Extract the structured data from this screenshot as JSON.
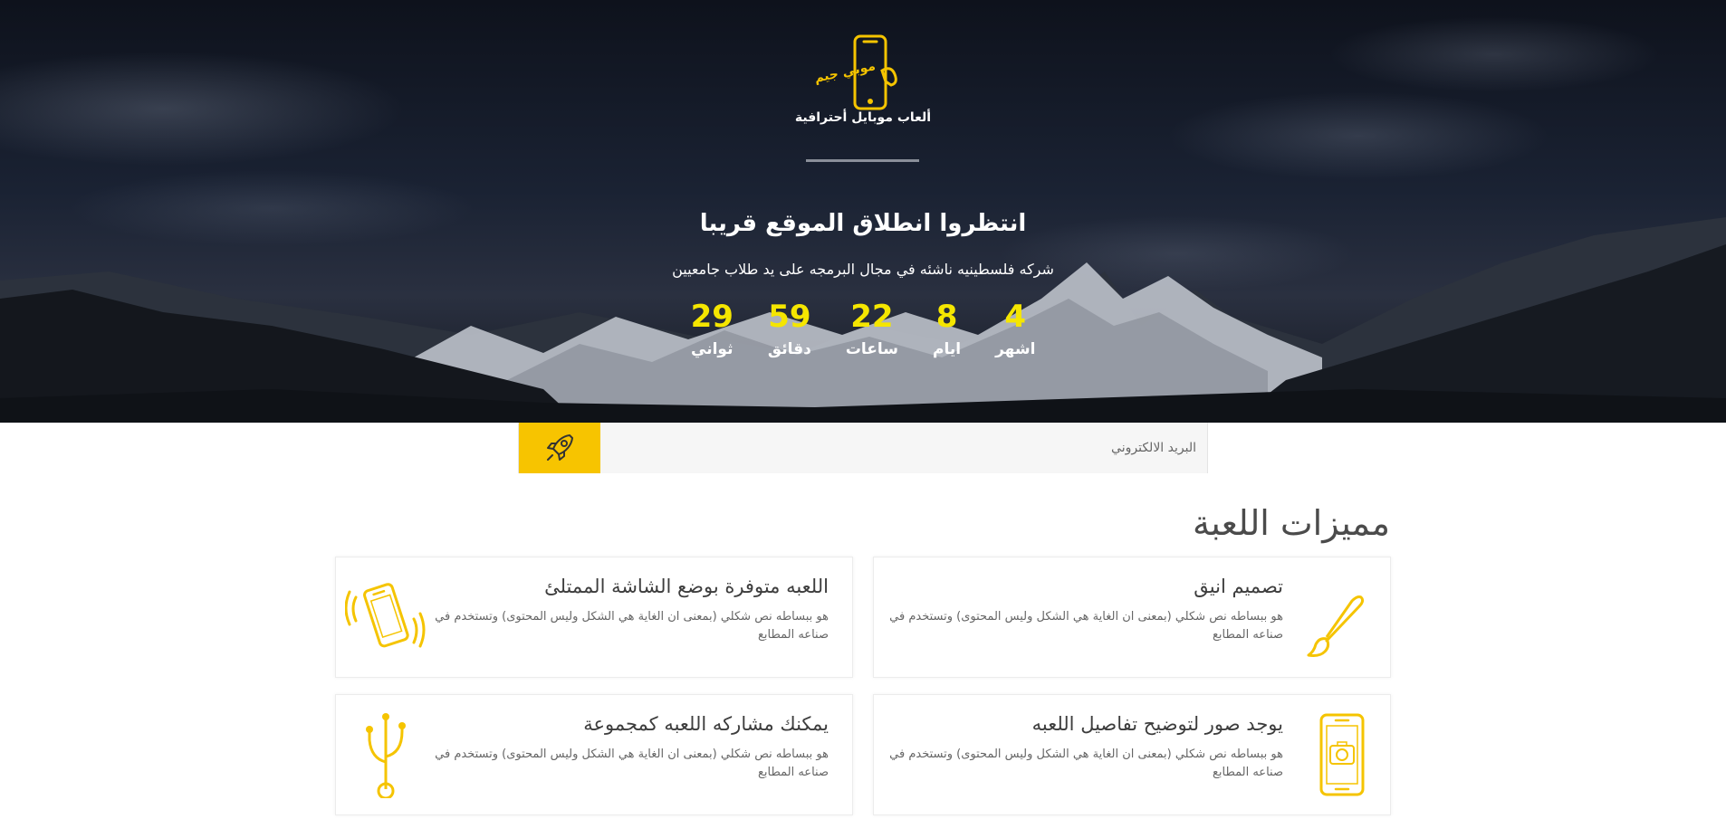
{
  "hero": {
    "logo_brand": "موبي جيم",
    "logo_tagline": "ألعاب موبايل أحترافية",
    "title": "انتظروا انطلاق الموقع قريبا",
    "subtitle": "شركه فلسطينيه ناشئه في مجال البرمجه على يد طلاب جامعيين"
  },
  "countdown": [
    {
      "value": "4",
      "label": "اشهر"
    },
    {
      "value": "8",
      "label": "ايام"
    },
    {
      "value": "22",
      "label": "ساعات"
    },
    {
      "value": "59",
      "label": "دقائق"
    },
    {
      "value": "29",
      "label": "ثواني"
    }
  ],
  "subscribe": {
    "placeholder": "البريد الالكتروني",
    "button_icon": "rocket-icon"
  },
  "features": {
    "title": "مميزات اللعبة",
    "items": [
      {
        "title": "تصميم انيق",
        "text": "هو ببساطه نص شكلي (بمعنى ان الغاية هي الشكل وليس المحتوى) وتستخدم في صناعه المطابع",
        "icon": "paintbrush-icon"
      },
      {
        "title": "اللعبه متوفرة بوضع الشاشة الممتلئ",
        "text": "هو ببساطه نص شكلي (بمعنى ان الغاية هي الشكل وليس المحتوى) وتستخدم في صناعه المطابع",
        "icon": "vibrating-phone-icon"
      },
      {
        "title": "يوجد صور لتوضيح تفاصيل اللعبه",
        "text": "هو ببساطه نص شكلي (بمعنى ان الغاية هي الشكل وليس المحتوى) وتستخدم في صناعه المطابع",
        "icon": "phone-camera-icon"
      },
      {
        "title": "يمكنك مشاركه اللعبه كمجموعة",
        "text": "هو ببساطه نص شكلي (بمعنى ان الغاية هي الشكل وليس المحتوى) وتستخدم في صناعه المطابع",
        "icon": "usb-share-icon"
      }
    ]
  },
  "colors": {
    "accent": "#f7c400",
    "countdown_value": "#f5e600"
  }
}
